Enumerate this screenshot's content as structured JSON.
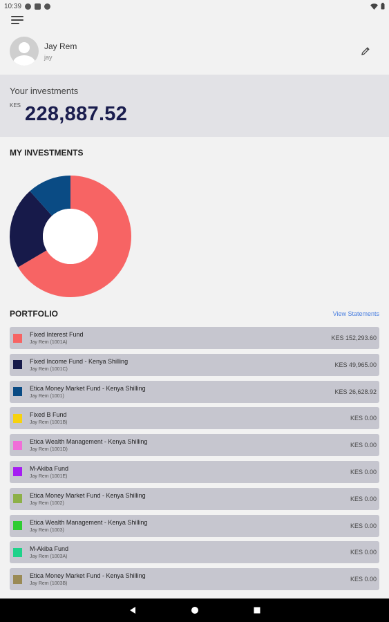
{
  "status_bar": {
    "time": "10:39"
  },
  "profile": {
    "name": "Jay Rem",
    "username": "jay"
  },
  "balance": {
    "label": "Your investments",
    "currency": "KES",
    "amount": "228,887.52"
  },
  "sections": {
    "my_investments": "MY INVESTMENTS",
    "portfolio": "PORTFOLIO",
    "view_statements": "View Statements"
  },
  "chart_data": {
    "type": "pie",
    "values": [
      152293.6,
      49965.0,
      26628.92
    ],
    "colors": [
      "#f76464",
      "#171a4a",
      "#0a4b84"
    ]
  },
  "funds": [
    {
      "name": "Fixed Interest Fund",
      "sub": "Jay Rem (1001A)",
      "value": "KES 152,293.60",
      "color": "#f76464"
    },
    {
      "name": "Fixed Income Fund - Kenya Shilling",
      "sub": "Jay Rem (1001C)",
      "value": "KES 49,965.00",
      "color": "#171a4a"
    },
    {
      "name": "Etica Money Market Fund - Kenya Shilling",
      "sub": "Jay Rem (1001)",
      "value": "KES 26,628.92",
      "color": "#0a4b84"
    },
    {
      "name": "Fixed B Fund",
      "sub": "Jay Rem (1001B)",
      "value": "KES 0.00",
      "color": "#f7d20f"
    },
    {
      "name": "Etica Wealth Management - Kenya Shilling",
      "sub": "Jay Rem (1001D)",
      "value": "KES 0.00",
      "color": "#f06ed8"
    },
    {
      "name": "M-Akiba Fund",
      "sub": "Jay Rem (1001E)",
      "value": "KES 0.00",
      "color": "#a51cf2"
    },
    {
      "name": "Etica Money Market Fund - Kenya Shilling",
      "sub": "Jay Rem (1002)",
      "value": "KES 0.00",
      "color": "#8db048"
    },
    {
      "name": "Etica Wealth Management - Kenya Shilling",
      "sub": "Jay Rem (1003)",
      "value": "KES 0.00",
      "color": "#2fcc32"
    },
    {
      "name": "M-Akiba Fund",
      "sub": "Jay Rem (1003A)",
      "value": "KES 0.00",
      "color": "#1fd28a"
    },
    {
      "name": "Etica Money Market Fund - Kenya Shilling",
      "sub": "Jay Rem (1003B)",
      "value": "KES 0.00",
      "color": "#9a8a55"
    }
  ]
}
